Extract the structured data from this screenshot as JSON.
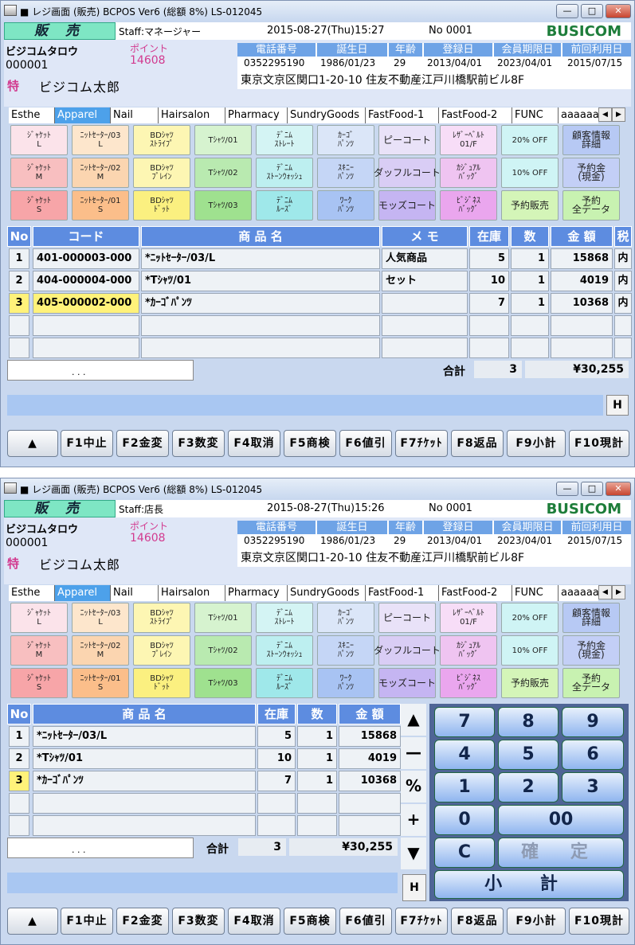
{
  "windows": [
    {
      "title": "■ レジ画面 (販売)  BCPOS Ver6 (総額 8%)  LS-012045",
      "mode": "販 売",
      "staff": "Staff:マネージャー",
      "datetime": "2015-08-27(Thu)15:27",
      "receipt_no": "No 0001",
      "brand": "BUSICOM",
      "customer": {
        "kana": "ビジコムタロウ",
        "id": "000001",
        "point_label": "ポイント",
        "point_value": "14608",
        "tok": "特",
        "name": "ビジコム太郎",
        "headers": [
          "電話番号",
          "誕生日",
          "年齢",
          "登録日",
          "会員期限日",
          "前回利用日"
        ],
        "values": [
          "0352295190",
          "1986/01/23",
          "29",
          "2013/04/01",
          "2023/04/01",
          "2015/07/15"
        ],
        "address": "東京文京区関口1-20-10 住友不動産江戸川橋駅前ビル8F"
      },
      "tabs": [
        "Esthe",
        "Apparel",
        "Nail",
        "Hairsalon",
        "Pharmacy",
        "SundryGoods",
        "FastFood-1",
        "FastFood-2",
        "FUNC",
        "aaaaaa"
      ],
      "selected_tab": "Apparel",
      "items": [
        [
          "ｼﾞｬｹｯﾄ\nL",
          "ﾆｯﾄｾｰﾀｰ/03\nL",
          "BDｼｬﾂ\nｽﾄﾗｲﾌﾟ",
          "Tｼｬﾂ/01",
          "ﾃﾞﾆﾑ\nｽﾄﾚｰﾄ",
          "ｶｰｺﾞ\nﾊﾟﾝﾂ",
          "ピーコート",
          "ﾚｻﾞｰﾍﾞﾙﾄ\n01/F",
          "20% OFF",
          "顧客情報\n詳細"
        ],
        [
          "ｼﾞｬｹｯﾄ\nM",
          "ﾆｯﾄｾｰﾀｰ/02\nM",
          "BDｼｬﾂ\nﾌﾟﾚｲﾝ",
          "Tｼｬﾂ/02",
          "ﾃﾞﾆﾑ\nｽﾄｰﾝｳｫｯｼｭ",
          "ｽｷﾆｰ\nﾊﾟﾝﾂ",
          "ダッフルコート",
          "ｶｼﾞｭｱﾙ\nﾊﾞｯｸﾞ",
          "10% OFF",
          "予約金\n(現金)"
        ],
        [
          "ｼﾞｬｹｯﾄ\nS",
          "ﾆｯﾄｾｰﾀｰ/01\nS",
          "BDｼｬﾂ\nﾄﾞｯﾄ",
          "Tｼｬﾂ/03",
          "ﾃﾞﾆﾑ\nﾙｰｽﾞ",
          "ﾜｰｸ\nﾊﾟﾝﾂ",
          "モッズコート",
          "ﾋﾞｼﾞﾈｽ\nﾊﾞｯｸﾞ",
          "予約販売",
          "予約\n全データ"
        ]
      ],
      "table_headers": [
        "No",
        "コード",
        "商 品 名",
        "メ モ",
        "在庫",
        "数",
        "金 額",
        "税"
      ],
      "rows": [
        [
          "1",
          "401-000003-000",
          "*ﾆｯﾄｾｰﾀｰ/03/L",
          "人気商品",
          "5",
          "1",
          "15868",
          "内"
        ],
        [
          "2",
          "404-000004-000",
          "*Tｼｬﾂ/01",
          "セット",
          "10",
          "1",
          "4019",
          "内"
        ],
        [
          "3",
          "405-000002-000",
          "*ｶｰｺﾞﾊﾟﾝﾂ",
          "",
          "7",
          "1",
          "10368",
          "内"
        ]
      ],
      "input_value": ".  . .",
      "total_label": "合計",
      "total_qty": "3",
      "total_amount": "¥30,255",
      "h_label": "H",
      "fkeys": [
        "▲",
        "F1中止",
        "F2金変",
        "F3数変",
        "F4取消",
        "F5商検",
        "F6値引",
        "F7ﾁｹｯﾄ",
        "F8返品",
        "F9小計",
        "F10現計"
      ]
    },
    {
      "title": "■ レジ画面 (販売)  BCPOS Ver6 (総額 8%)  LS-012045",
      "mode": "販 売",
      "staff": "Staff:店長",
      "datetime": "2015-08-27(Thu)15:26",
      "receipt_no": "No 0001",
      "brand": "BUSICOM",
      "customer": {
        "kana": "ビジコムタロウ",
        "id": "000001",
        "point_label": "ポイント",
        "point_value": "14608",
        "tok": "特",
        "name": "ビジコム太郎",
        "headers": [
          "電話番号",
          "誕生日",
          "年齢",
          "登録日",
          "会員期限日",
          "前回利用日"
        ],
        "values": [
          "0352295190",
          "1986/01/23",
          "29",
          "2013/04/01",
          "2023/04/01",
          "2015/07/15"
        ],
        "address": "東京文京区関口1-20-10 住友不動産江戸川橋駅前ビル8F"
      },
      "tabs": [
        "Esthe",
        "Apparel",
        "Nail",
        "Hairsalon",
        "Pharmacy",
        "SundryGoods",
        "FastFood-1",
        "FastFood-2",
        "FUNC",
        "aaaaaa"
      ],
      "selected_tab": "Apparel",
      "items": [
        [
          "ｼﾞｬｹｯﾄ\nL",
          "ﾆｯﾄｾｰﾀｰ/03\nL",
          "BDｼｬﾂ\nｽﾄﾗｲﾌﾟ",
          "Tｼｬﾂ/01",
          "ﾃﾞﾆﾑ\nｽﾄﾚｰﾄ",
          "ｶｰｺﾞ\nﾊﾟﾝﾂ",
          "ピーコート",
          "ﾚｻﾞｰﾍﾞﾙﾄ\n01/F",
          "20% OFF",
          "顧客情報\n詳細"
        ],
        [
          "ｼﾞｬｹｯﾄ\nM",
          "ﾆｯﾄｾｰﾀｰ/02\nM",
          "BDｼｬﾂ\nﾌﾟﾚｲﾝ",
          "Tｼｬﾂ/02",
          "ﾃﾞﾆﾑ\nｽﾄｰﾝｳｫｯｼｭ",
          "ｽｷﾆｰ\nﾊﾟﾝﾂ",
          "ダッフルコート",
          "ｶｼﾞｭｱﾙ\nﾊﾞｯｸﾞ",
          "10% OFF",
          "予約金\n(現金)"
        ],
        [
          "ｼﾞｬｹｯﾄ\nS",
          "ﾆｯﾄｾｰﾀｰ/01\nS",
          "BDｼｬﾂ\nﾄﾞｯﾄ",
          "Tｼｬﾂ/03",
          "ﾃﾞﾆﾑ\nﾙｰｽﾞ",
          "ﾜｰｸ\nﾊﾟﾝﾂ",
          "モッズコート",
          "ﾋﾞｼﾞﾈｽ\nﾊﾞｯｸﾞ",
          "予約販売",
          "予約\n全データ"
        ]
      ],
      "table_headers": [
        "No",
        "商 品 名",
        "在庫",
        "数",
        "金 額"
      ],
      "rows": [
        [
          "1",
          "*ﾆｯﾄｾｰﾀｰ/03/L",
          "5",
          "1",
          "15868"
        ],
        [
          "2",
          "*Tｼｬﾂ/01",
          "10",
          "1",
          "4019"
        ],
        [
          "3",
          "*ｶｰｺﾞﾊﾟﾝﾂ",
          "7",
          "1",
          "10368"
        ]
      ],
      "side_buttons": [
        "▲",
        "—",
        "%",
        "+",
        "▼"
      ],
      "numpad": [
        "7",
        "8",
        "9",
        "4",
        "5",
        "6",
        "1",
        "2",
        "3",
        "0",
        "00",
        "C",
        "確 定",
        "小 計"
      ],
      "input_value": ".  . .",
      "total_label": "合計",
      "total_qty": "3",
      "total_amount": "¥30,255",
      "h_label": "H",
      "fkeys": [
        "▲",
        "F1中止",
        "F2金変",
        "F3数変",
        "F4取消",
        "F5商検",
        "F6値引",
        "F7ﾁｹｯﾄ",
        "F8返品",
        "F9小計",
        "F10現計"
      ]
    }
  ]
}
